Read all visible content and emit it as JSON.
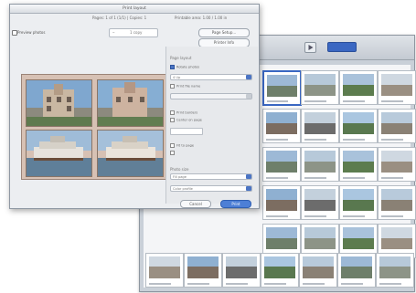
{
  "dialog": {
    "title": "Print layout",
    "pages": "Pages: 1 of 1 (1/1) | Copies: 1",
    "printable_area": "Printable area: 1.00 / 1.00 in",
    "preview_label": "Preview photos",
    "copies_value": "1 copy",
    "page_setup_button": "Page Setup...",
    "print_button_top": "Printer Info",
    "cancel_label": "Cancel",
    "print_label": "Print"
  },
  "options": {
    "header_page_layout": "Page layout",
    "layout_select": "4 Up",
    "checkbox_rotate": "Rotate photos",
    "checkbox_labels": "Print file name",
    "checkbox_borders": "Print borders",
    "checkbox_center": "Center on page",
    "checkbox_fit": "Fit to page",
    "header_photo_size": "Photo size",
    "size_select": "Fill page",
    "header_channel": "Color profile"
  },
  "colors": {
    "accent": "#4b74c4",
    "sheet": "#d7c1b4"
  }
}
